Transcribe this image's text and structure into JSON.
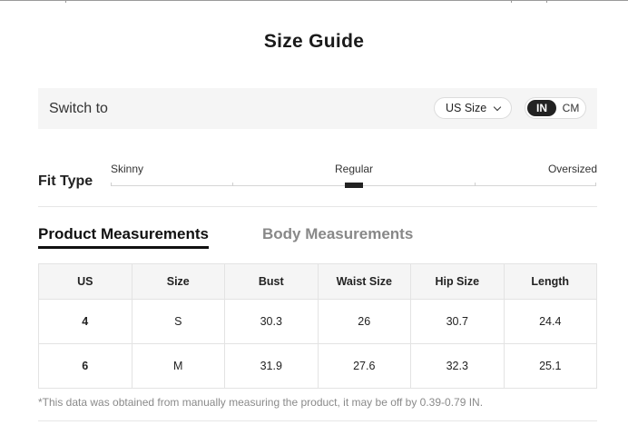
{
  "title": "Size Guide",
  "switch": {
    "label": "Switch to",
    "size_system": "US Size",
    "units": {
      "active": "IN",
      "inactive": "CM"
    }
  },
  "fit": {
    "label": "Fit Type",
    "options": [
      "Skinny",
      "Regular",
      "Oversized"
    ],
    "selected": "Regular"
  },
  "tabs": {
    "active": "Product Measurements",
    "inactive": "Body Measurements"
  },
  "table": {
    "headers": [
      "US",
      "Size",
      "Bust",
      "Waist Size",
      "Hip Size",
      "Length"
    ],
    "rows": [
      [
        "4",
        "S",
        "30.3",
        "26",
        "30.7",
        "24.4"
      ],
      [
        "6",
        "M",
        "31.9",
        "27.6",
        "32.3",
        "25.1"
      ]
    ]
  },
  "note": "*This data was obtained from manually measuring the product, it may be off by 0.39-0.79 IN."
}
